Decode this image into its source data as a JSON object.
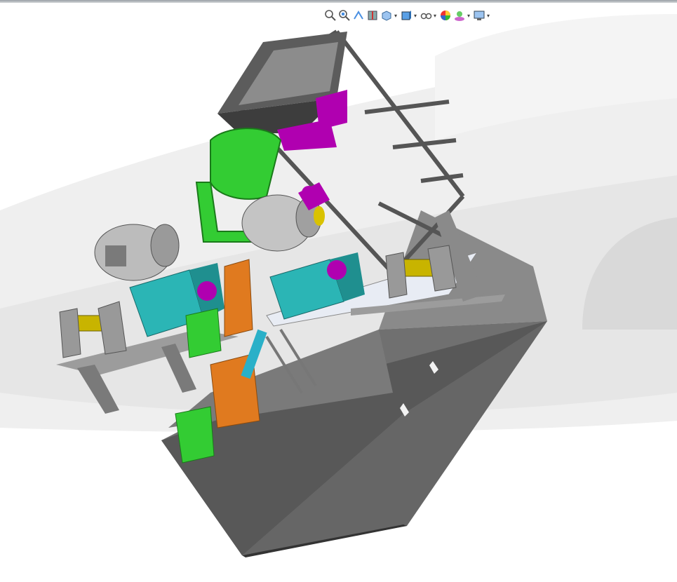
{
  "app": {
    "type": "3D CAD model viewport"
  },
  "heads_up_toolbar": {
    "buttons": [
      {
        "icon": "zoom-to-fit-icon",
        "has_dropdown": false
      },
      {
        "icon": "zoom-to-area-icon",
        "has_dropdown": false
      },
      {
        "icon": "previous-view-icon",
        "has_dropdown": false
      },
      {
        "icon": "section-view-icon",
        "has_dropdown": false
      },
      {
        "icon": "view-orientation-icon",
        "has_dropdown": true
      },
      {
        "icon": "display-style-icon",
        "has_dropdown": true
      },
      {
        "icon": "hide-show-items-icon",
        "has_dropdown": true
      },
      {
        "icon": "edit-appearance-icon",
        "has_dropdown": false
      },
      {
        "icon": "apply-scene-icon",
        "has_dropdown": true
      },
      {
        "icon": "view-settings-icon",
        "has_dropdown": true
      }
    ]
  },
  "colors": {
    "background": "#ffffff",
    "background_swoosh": "#e6e6e6",
    "frame_steel": "#6e6e6e",
    "base_block": "#555555",
    "motor": "#b5b5b5",
    "green_parts": "#33cc33",
    "cyan_blocks": "#2bb5b5",
    "orange_parts": "#e07a1f",
    "magenta_parts": "#b000b0",
    "yellow_shafts": "#c8b400",
    "light_plate": "#e8ecf4"
  }
}
